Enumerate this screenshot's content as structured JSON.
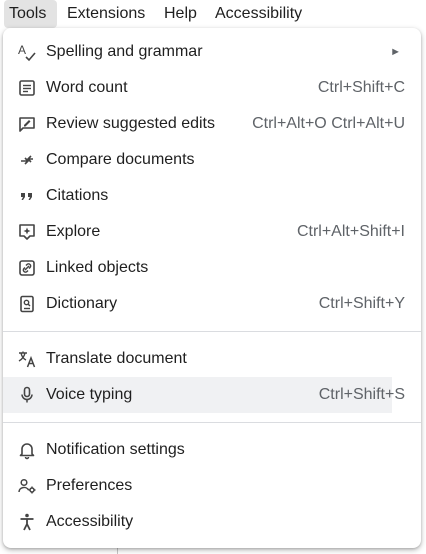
{
  "menubar": {
    "items": [
      {
        "label": "Tools"
      },
      {
        "label": "Extensions"
      },
      {
        "label": "Help"
      },
      {
        "label": "Accessibility"
      }
    ]
  },
  "tools_menu": {
    "items": [
      {
        "label": "Spelling and grammar",
        "shortcut": "",
        "icon": "spellcheck-icon",
        "has_submenu": true
      },
      {
        "label": "Word count",
        "shortcut": "Ctrl+Shift+C",
        "icon": "word-count-icon"
      },
      {
        "label": "Review suggested edits",
        "shortcut": "Ctrl+Alt+O Ctrl+Alt+U",
        "icon": "review-edits-icon"
      },
      {
        "label": "Compare documents",
        "shortcut": "",
        "icon": "compare-icon"
      },
      {
        "label": "Citations",
        "shortcut": "",
        "icon": "quote-icon"
      },
      {
        "label": "Explore",
        "shortcut": "Ctrl+Alt+Shift+I",
        "icon": "explore-icon"
      },
      {
        "label": "Linked objects",
        "shortcut": "",
        "icon": "link-icon"
      },
      {
        "label": "Dictionary",
        "shortcut": "Ctrl+Shift+Y",
        "icon": "dictionary-icon"
      },
      {
        "label": "Translate document",
        "shortcut": "",
        "icon": "translate-icon"
      },
      {
        "label": "Voice typing",
        "shortcut": "Ctrl+Shift+S",
        "icon": "microphone-icon",
        "highlighted": true
      },
      {
        "label": "Notification settings",
        "shortcut": "",
        "icon": "bell-icon"
      },
      {
        "label": "Preferences",
        "shortcut": "",
        "icon": "preferences-icon"
      },
      {
        "label": "Accessibility",
        "shortcut": "",
        "icon": "accessibility-icon"
      }
    ],
    "submenu_arrow": "►"
  },
  "colors": {
    "highlight": "#f0f1f3",
    "text": "#1f1f1f",
    "shortcut": "#5f6368",
    "separator": "#dadce0"
  }
}
